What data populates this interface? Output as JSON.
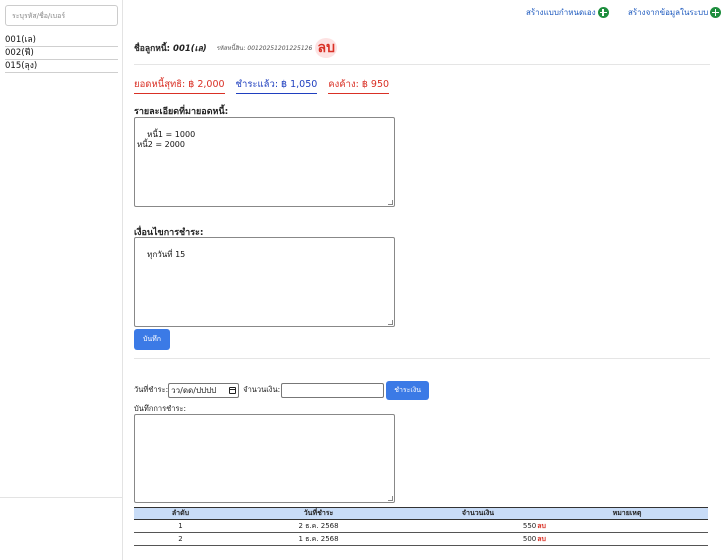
{
  "sidebar": {
    "search_placeholder": "ระบุรหัส/ชื่อ/เบอร์",
    "debtors": [
      "001(เล)",
      "002(ฟี)",
      "015(ลุง)"
    ]
  },
  "topbar": {
    "create_custom": "สร้างแบบกำหนดเอง",
    "create_from_system": "สร้างจากข้อมูลในระบบ"
  },
  "header": {
    "name_label": "ชื่อลูกหนี้:",
    "name_value": "001(เล)",
    "code_label": "รหัสหนี้สิน:",
    "code_value": "00120251201225126",
    "delete_label": "ลบ"
  },
  "summary": {
    "net": "ยอดหนี้สุทธิ: ฿ 2,000",
    "paid": "ชำระแล้ว: ฿ 1,050",
    "remaining": "คงค้าง: ฿ 950"
  },
  "detail": {
    "label": "รายละเอียดที่มายอดหนี้:",
    "value": "หนี้1 = 1000\nหนี้2 = 2000"
  },
  "condition": {
    "label": "เงื่อนไขการชำระ:",
    "value": "ทุกวันที่ 15"
  },
  "save_button": "บันทึก",
  "payment": {
    "date_label": "วันที่ชำระ:",
    "date_placeholder": "วว/ดด/ปปปป",
    "amount_label": "จำนวนเงิน:",
    "pay_button": "ชำระเงิน",
    "note_label": "บันทึกการชำระ:"
  },
  "table": {
    "headers": [
      "ลำดับ",
      "วันที่ชำระ",
      "จำนวนเงิน",
      "หมายเหตุ"
    ],
    "rows": [
      {
        "no": "1",
        "date": "2 ธ.ค. 2568",
        "amount": "550",
        "delete": "ลบ",
        "note": ""
      },
      {
        "no": "2",
        "date": "1 ธ.ค. 2568",
        "amount": "500",
        "delete": "ลบ",
        "note": ""
      }
    ]
  },
  "colors": {
    "accent": "#3b7ae6",
    "danger": "#d93025",
    "paid": "#1f3fbf",
    "table_header": "#c8dcf7",
    "plus_icon": "#1e8e3e"
  }
}
